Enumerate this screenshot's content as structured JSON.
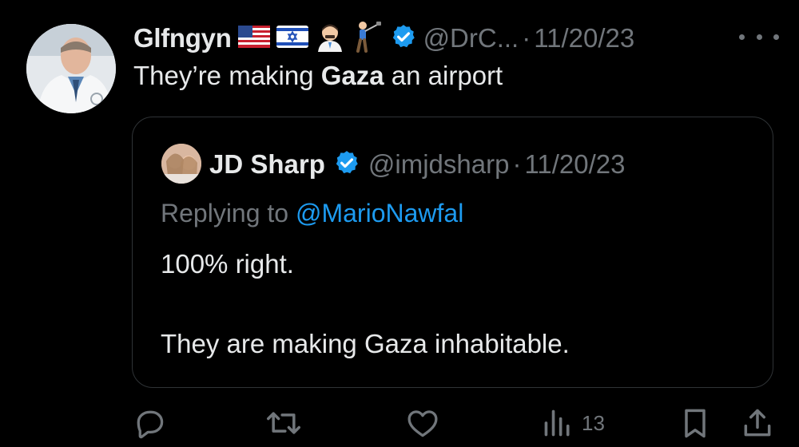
{
  "tweet": {
    "author_name": "Glfngyn",
    "author_emojis": [
      "us-flag",
      "israel-flag",
      "man-health-worker",
      "person-golfing"
    ],
    "handle": "@DrC...",
    "separator": "·",
    "date": "11/20/23",
    "text_before": "They’re making ",
    "text_bold": "Gaza",
    "text_after": " an airport"
  },
  "quoted_tweet": {
    "author_name": "JD Sharp",
    "handle": "@imjdsharp",
    "separator": "·",
    "date": "11/20/23",
    "replying_prefix": "Replying to ",
    "replying_to": "@MarioNawfal",
    "line_1": "100% right.",
    "line_2": "They are making Gaza inhabitable."
  },
  "actions": {
    "views_count": "13",
    "icons": [
      "reply-icon",
      "retweet-icon",
      "like-icon",
      "views-icon",
      "bookmark-icon",
      "share-icon"
    ]
  },
  "colors": {
    "background": "#000000",
    "text_primary": "#e7e9ea",
    "text_secondary": "#71767b",
    "link": "#1d9bf0",
    "verified": "#1d9bf0",
    "border": "#2f3336"
  }
}
